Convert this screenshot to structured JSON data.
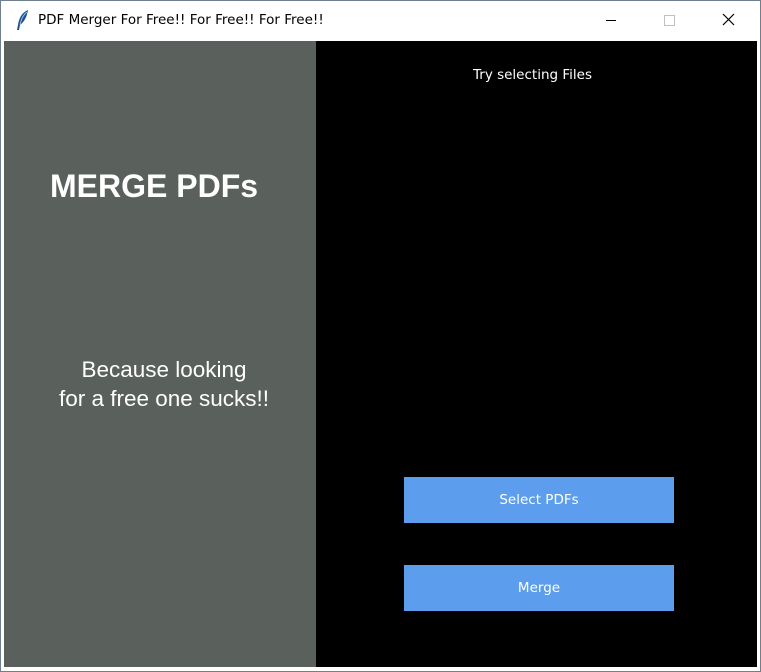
{
  "window": {
    "title": "PDF Merger For Free!! For Free!! For Free!!",
    "app_icon": "feather-icon",
    "controls": {
      "minimize_icon": "minimize-icon",
      "maximize_icon": "maximize-icon",
      "close_icon": "close-icon"
    }
  },
  "left_panel": {
    "heading": "MERGE PDFs",
    "tagline_line1": "Because looking",
    "tagline_line2": "for a free one sucks!!"
  },
  "right_panel": {
    "status_text": "Try selecting Files",
    "select_button_label": "Select PDFs",
    "merge_button_label": "Merge"
  },
  "colors": {
    "left_panel_bg": "#5a615d",
    "right_panel_bg": "#000000",
    "button_bg": "#5c9ded",
    "text": "#ffffff"
  }
}
